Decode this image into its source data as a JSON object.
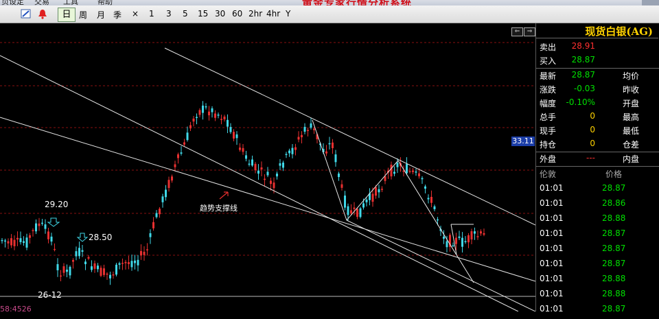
{
  "menubar": {
    "title": "黄金专家行情分析系统",
    "items": [
      "页设定",
      "交易",
      "工具",
      "帮助"
    ]
  },
  "toolbar": {
    "periods": [
      "日",
      "周",
      "月",
      "季",
      "×",
      "1",
      "3",
      "5",
      "15",
      "30",
      "60",
      "2hr",
      "4hr",
      "Y"
    ]
  },
  "chart": {
    "price_badge": "33.11",
    "annotations": {
      "high_label": "29.20",
      "mid_label": "28.50",
      "date_label": "26-12",
      "support_label": "趋势支撑线"
    },
    "bottom_cut_text": "58:4526"
  },
  "panel": {
    "title": "现货白银(AG)",
    "rows": [
      {
        "label": "卖出",
        "value": "28.91",
        "color": "#ff3030",
        "label2": ""
      },
      {
        "label": "买入",
        "value": "28.87",
        "color": "#00e000",
        "label2": ""
      },
      {
        "label": "最新",
        "value": "28.87",
        "color": "#00e000",
        "label2": "均价"
      },
      {
        "label": "涨跌",
        "value": "-0.03",
        "color": "#00e000",
        "label2": "昨收"
      },
      {
        "label": "幅度",
        "value": "-0.10%",
        "color": "#00e000",
        "label2": "开盘"
      },
      {
        "label": "总手",
        "value": "0",
        "color": "#ffd200",
        "label2": "最高"
      },
      {
        "label": "现手",
        "value": "0",
        "color": "#ffd200",
        "label2": "最低"
      },
      {
        "label": "持仓",
        "value": "0",
        "color": "#ffd200",
        "label2": "仓差"
      },
      {
        "label": "外盘",
        "value": "---",
        "color": "#ff3030",
        "label2": "内盘"
      }
    ],
    "ticks_header": {
      "time": "伦敦",
      "price": "价格"
    },
    "ticks": [
      {
        "time": "01:01",
        "price": "28.87"
      },
      {
        "time": "01:01",
        "price": "28.86"
      },
      {
        "time": "01:01",
        "price": "28.88"
      },
      {
        "time": "01:01",
        "price": "28.87"
      },
      {
        "time": "01:01",
        "price": "28.87"
      },
      {
        "time": "01:01",
        "price": "28.87"
      },
      {
        "time": "01:01",
        "price": "28.88"
      },
      {
        "time": "01:01",
        "price": "28.88"
      },
      {
        "time": "01:01",
        "price": "28.87"
      }
    ]
  },
  "colors": {
    "up": "#e83030",
    "down": "#40d8e8",
    "trendline": "#e8e8e8",
    "grid": "#8a1010"
  }
}
